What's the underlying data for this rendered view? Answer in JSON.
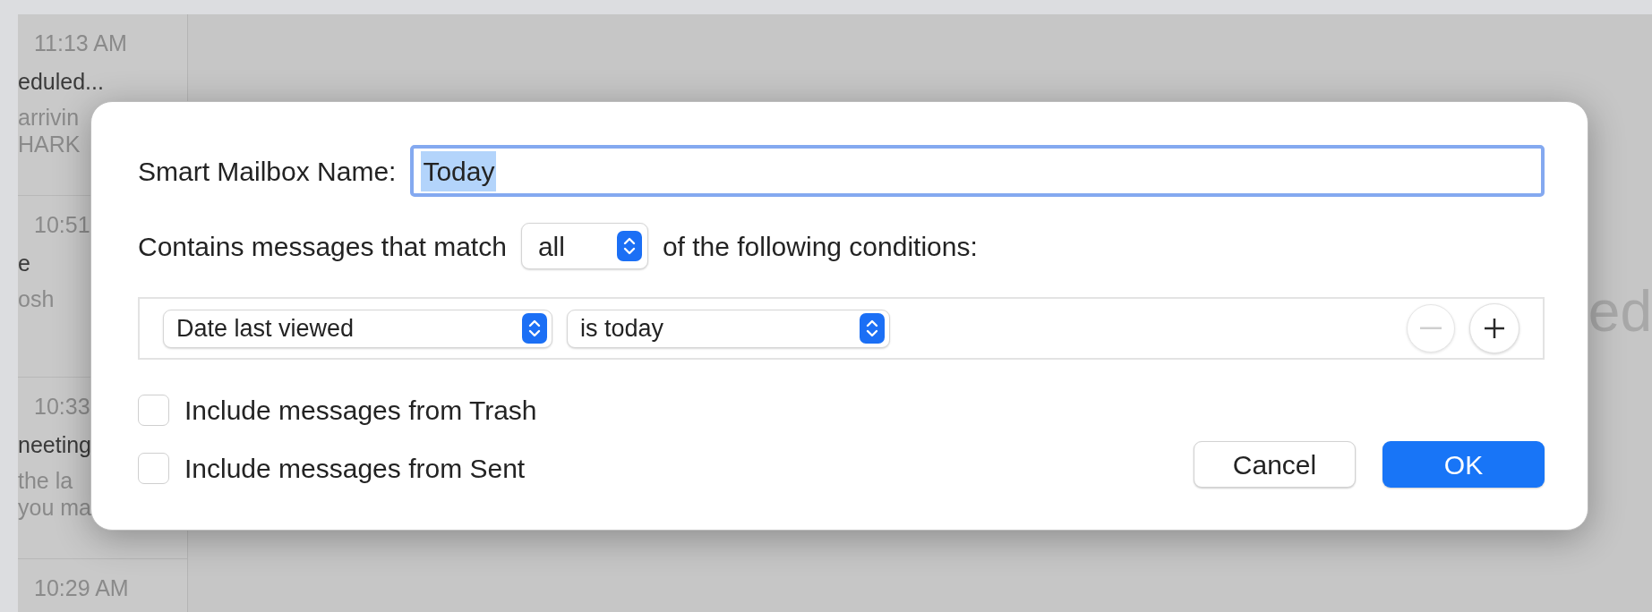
{
  "background": {
    "message_list": [
      {
        "time": "11:13 AM",
        "lines": [
          "eduled...",
          "arrivin",
          "HARK"
        ]
      },
      {
        "time": "10:51",
        "lines": [
          "e",
          "osh"
        ]
      },
      {
        "time": "10:33",
        "lines": [
          "neeting",
          "the la",
          "you ma"
        ]
      },
      {
        "time": "10:29 AM"
      }
    ],
    "detail_text": "ed"
  },
  "dialog": {
    "name_label": "Smart Mailbox Name:",
    "name_value": "Today",
    "name_selected": true,
    "match_prefix": "Contains messages that match",
    "match_value": "all",
    "match_suffix": "of the following conditions:",
    "conditions": [
      {
        "field": "Date last viewed",
        "operator": "is today",
        "remove_disabled": true
      }
    ],
    "checkboxes": [
      {
        "label": "Include messages from Trash",
        "checked": false
      },
      {
        "label": "Include messages from Sent",
        "checked": false
      }
    ],
    "buttons": [
      {
        "label": "Cancel",
        "kind": "secondary"
      },
      {
        "label": "OK",
        "kind": "default"
      }
    ]
  }
}
